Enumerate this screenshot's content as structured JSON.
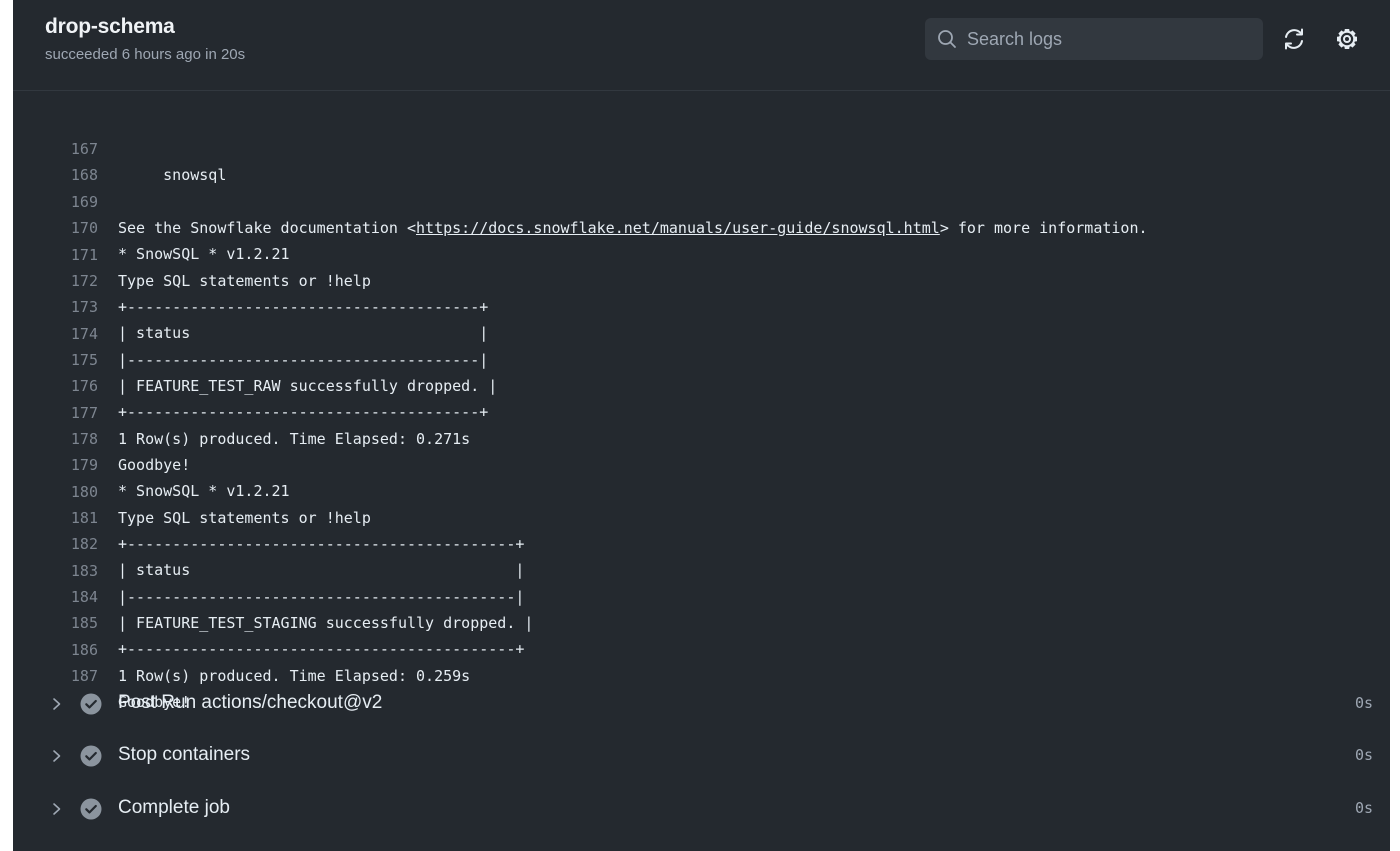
{
  "header": {
    "title": "drop-schema",
    "subtitle": "succeeded 6 hours ago in 20s",
    "search_placeholder": "Search logs"
  },
  "icons": {
    "search": "search-icon",
    "refresh": "refresh-icon",
    "settings": "gear-icon",
    "expand": "chevron-right-icon",
    "status": "check-circle-icon"
  },
  "colors": {
    "background": "#24292f",
    "text": "#e6edf3",
    "muted": "#9ea7b3",
    "line_number": "#7d8590",
    "check": "#8b949e"
  },
  "log_lines": [
    {
      "n": "167",
      "t": "     snowsql"
    },
    {
      "n": "168",
      "t": ""
    },
    {
      "n": "169",
      "pre": "See the Snowflake documentation <",
      "link": "https://docs.snowflake.net/manuals/user-guide/snowsql.html",
      "post": "> for more information."
    },
    {
      "n": "170",
      "t": "* SnowSQL * v1.2.21"
    },
    {
      "n": "171",
      "t": "Type SQL statements or !help"
    },
    {
      "n": "172",
      "t": "+---------------------------------------+"
    },
    {
      "n": "173",
      "t": "| status                                |"
    },
    {
      "n": "174",
      "t": "|---------------------------------------|"
    },
    {
      "n": "175",
      "t": "| FEATURE_TEST_RAW successfully dropped. |"
    },
    {
      "n": "176",
      "t": "+---------------------------------------+"
    },
    {
      "n": "177",
      "t": "1 Row(s) produced. Time Elapsed: 0.271s"
    },
    {
      "n": "178",
      "t": "Goodbye!"
    },
    {
      "n": "179",
      "t": "* SnowSQL * v1.2.21"
    },
    {
      "n": "180",
      "t": "Type SQL statements or !help"
    },
    {
      "n": "181",
      "t": "+-------------------------------------------+"
    },
    {
      "n": "182",
      "t": "| status                                    |"
    },
    {
      "n": "183",
      "t": "|-------------------------------------------|"
    },
    {
      "n": "184",
      "t": "| FEATURE_TEST_STAGING successfully dropped. |"
    },
    {
      "n": "185",
      "t": "+-------------------------------------------+"
    },
    {
      "n": "186",
      "t": "1 Row(s) produced. Time Elapsed: 0.259s"
    },
    {
      "n": "187",
      "t": "Goodbye!"
    }
  ],
  "steps": [
    {
      "label": "Post Run actions/checkout@v2",
      "duration": "0s"
    },
    {
      "label": "Stop containers",
      "duration": "0s"
    },
    {
      "label": "Complete job",
      "duration": "0s"
    }
  ]
}
